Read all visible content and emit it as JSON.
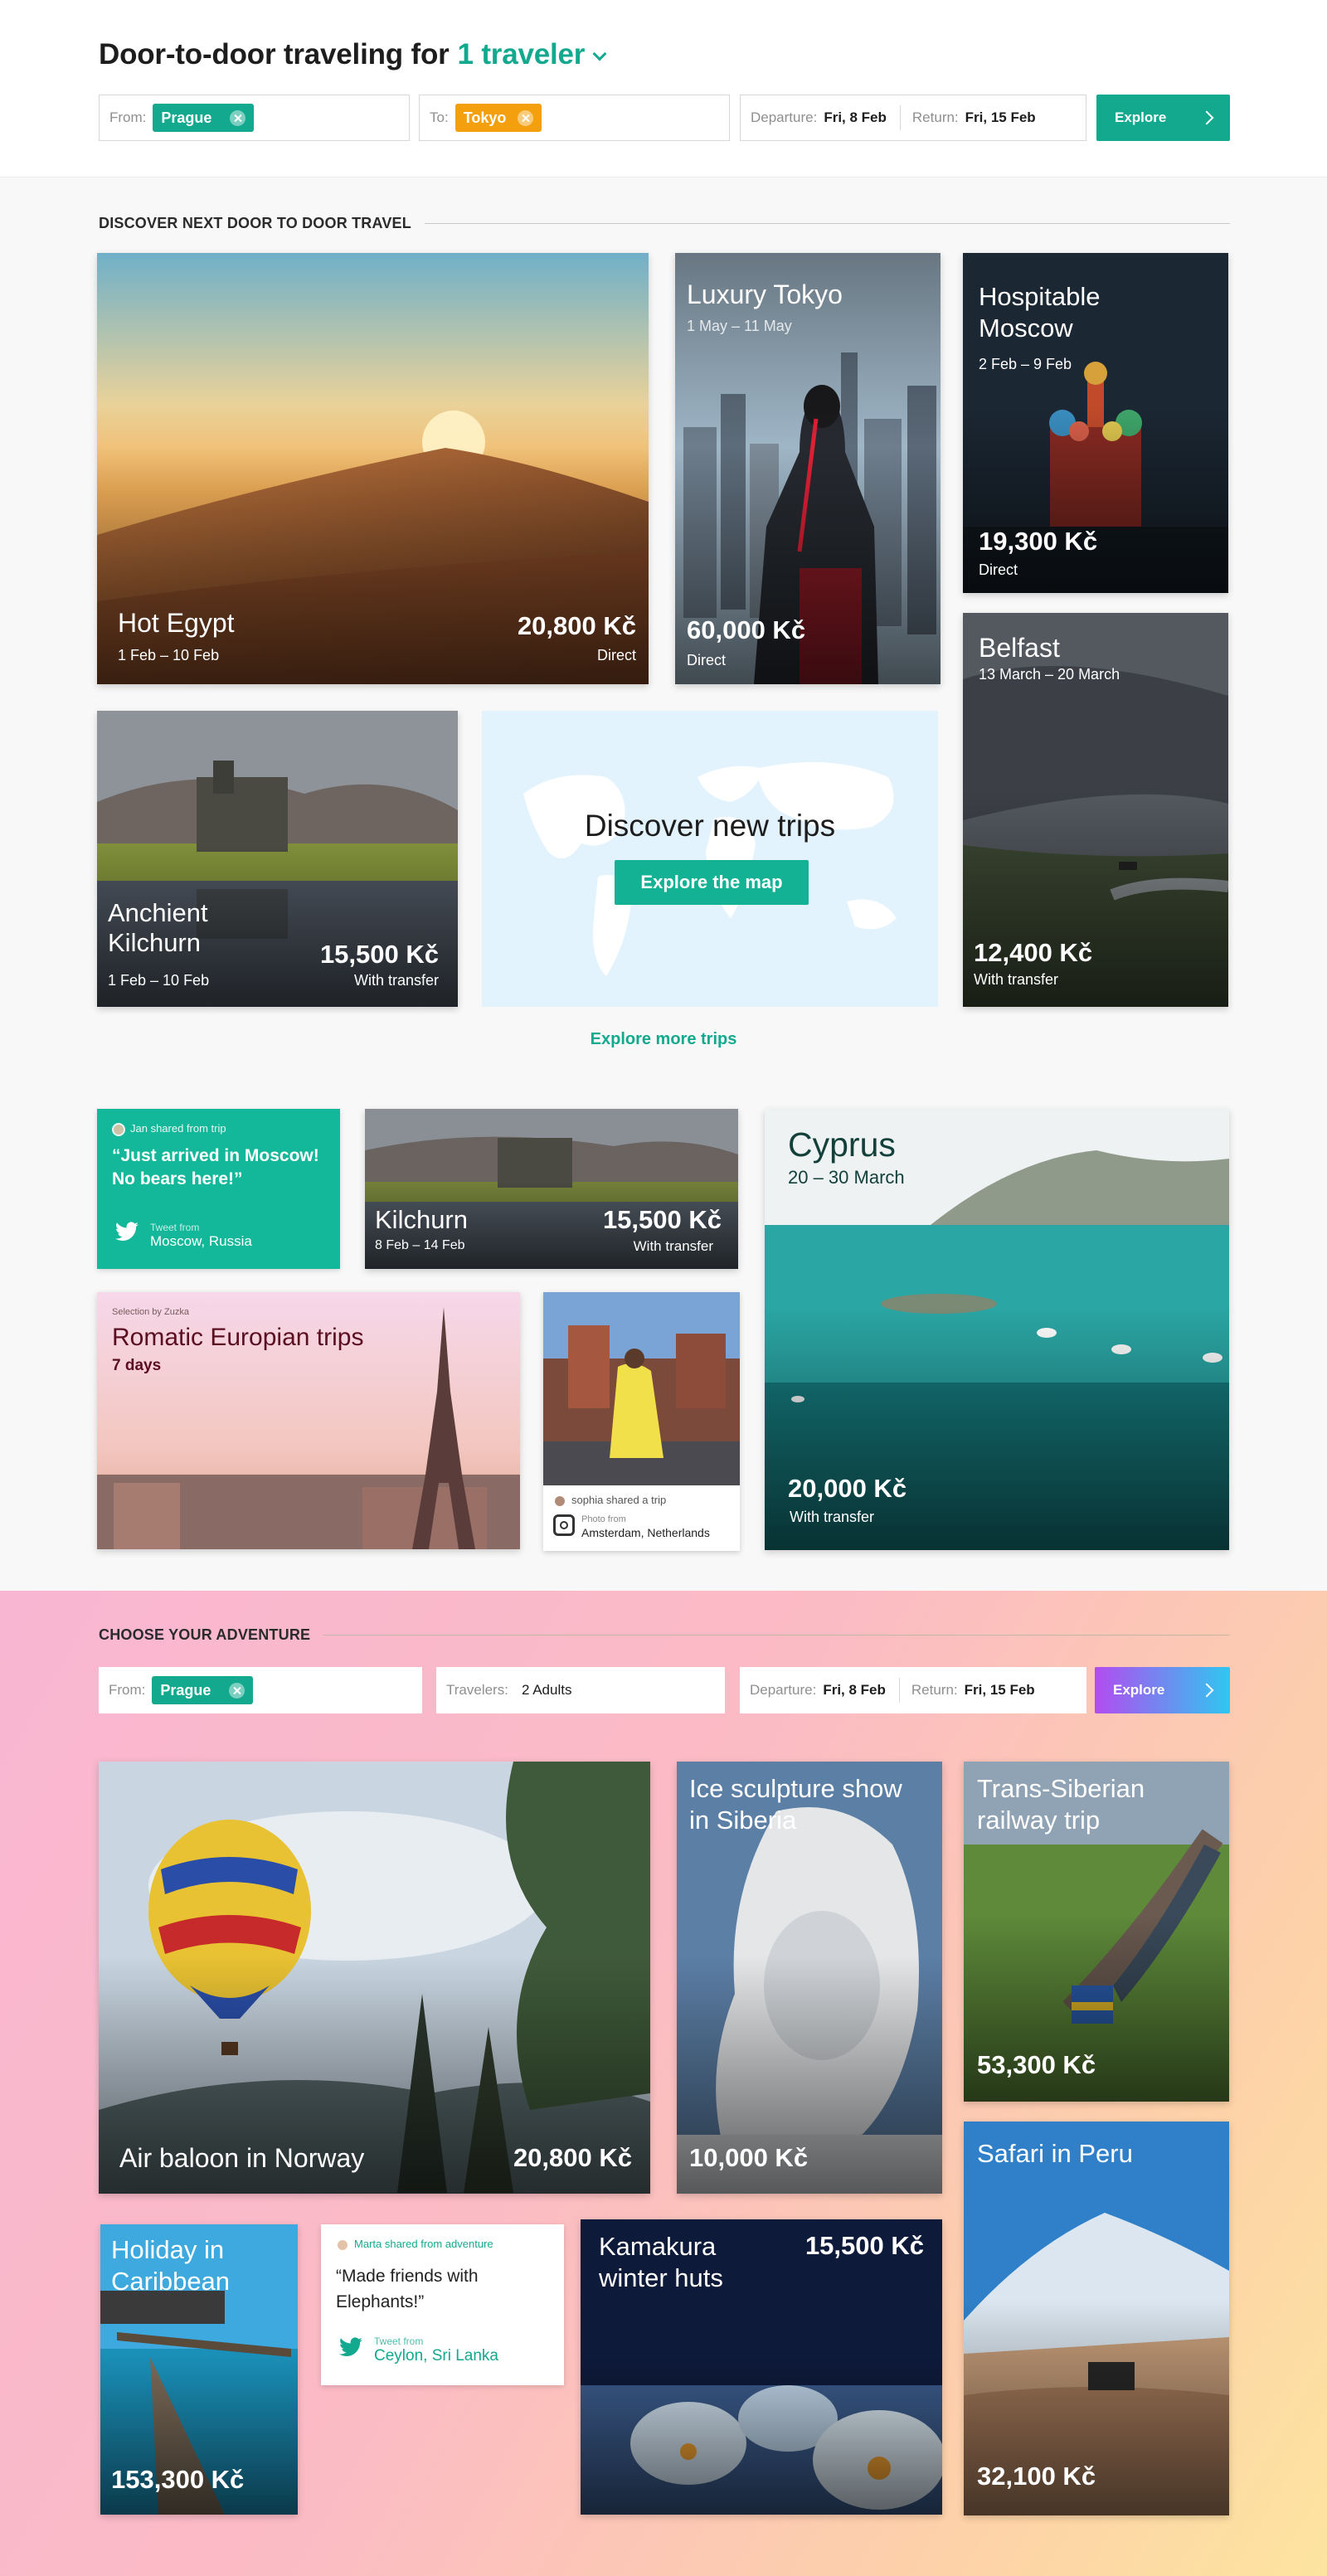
{
  "header": {
    "title": "Door-to-door traveling for",
    "travelers": "1 traveler",
    "from_label": "From:",
    "from_value": "Prague",
    "to_label": "To:",
    "to_value": "Tokyo",
    "departure_label": "Departure:",
    "departure_value": "Fri, 8 Feb",
    "return_label": "Return:",
    "return_value": "Fri, 15 Feb",
    "explore_label": "Explore"
  },
  "discover": {
    "section_title": "DISCOVER NEXT DOOR TO DOOR TRAVEL",
    "cards": {
      "egypt": {
        "title": "Hot Egypt",
        "dates": "1 Feb – 10 Feb",
        "price": "20,800 Kč",
        "note": "Direct"
      },
      "tokyo": {
        "title": "Luxury Tokyo",
        "dates": "1 May – 11 May",
        "price": "60,000 Kč",
        "note": "Direct"
      },
      "moscow": {
        "title": "Hospitable Moscow",
        "dates": "2 Feb – 9 Feb",
        "price": "19,300 Kč",
        "note": "Direct"
      },
      "kilchurn": {
        "title": "Anchient Kilchurn",
        "dates": "1 Feb – 10 Feb",
        "price": "15,500 Kč",
        "note": "With transfer"
      },
      "belfast": {
        "title": "Belfast",
        "dates": "13 March – 20 March",
        "price": "12,400 Kč",
        "note": "With transfer"
      }
    },
    "map": {
      "title": "Discover new trips",
      "button": "Explore the map"
    },
    "more_link": "Explore more trips"
  },
  "shared": {
    "tweet_moscow": {
      "shared_by": "Jan shared from trip",
      "quote": "“Just arrived in Moscow! No bears here!”",
      "source_label": "Tweet from",
      "location": "Moscow, Russia"
    },
    "kilchurn": {
      "title": "Kilchurn",
      "dates": "8 Feb – 14 Feb",
      "price": "15,500 Kč",
      "note": "With transfer"
    },
    "cyprus": {
      "title": "Cyprus",
      "dates": "20 – 30 March",
      "price": "20,000 Kč",
      "note": "With transfer"
    },
    "romantic": {
      "selection": "Selection by Zuzka",
      "title": "Romatic Europian trips",
      "days": "7 days"
    },
    "insta": {
      "shared_by": "sophia shared a trip",
      "source_label": "Photo from",
      "location": "Amsterdam, Netherlands"
    }
  },
  "adventure": {
    "section_title": "CHOOSE YOUR ADVENTURE",
    "from_label": "From:",
    "from_value": "Prague",
    "travelers_label": "Travelers:",
    "travelers_value": "2 Adults",
    "departure_label": "Departure:",
    "departure_value": "Fri, 8 Feb",
    "return_label": "Return:",
    "return_value": "Fri, 15 Feb",
    "explore_label": "Explore",
    "cards": {
      "norway": {
        "title": "Air baloon in Norway",
        "price": "20,800 Kč"
      },
      "siberia": {
        "title": "Ice sculpture show in Siberia",
        "price": "10,000 Kč"
      },
      "trans": {
        "title": "Trans-Siberian railway trip",
        "price": "53,300 Kč"
      },
      "peru": {
        "title": "Safari in Peru",
        "price": "32,100 Kč"
      },
      "caribbean": {
        "title": "Holiday in Caribbean",
        "price": "153,300 Kč"
      },
      "kamakura": {
        "title": "Kamakura winter huts",
        "price": "15,500 Kč"
      }
    },
    "tweet_srilanka": {
      "shared_by": "Marta shared from adventure",
      "quote": "“Made friends with Elephants!”",
      "source_label": "Tweet from",
      "location": "Ceylon, Sri Lanka"
    }
  },
  "colors": {
    "accent": "#13a98f",
    "orange": "#f4a00e",
    "explore_gradient": [
      "#b24cf0",
      "#2fc7f0"
    ]
  }
}
